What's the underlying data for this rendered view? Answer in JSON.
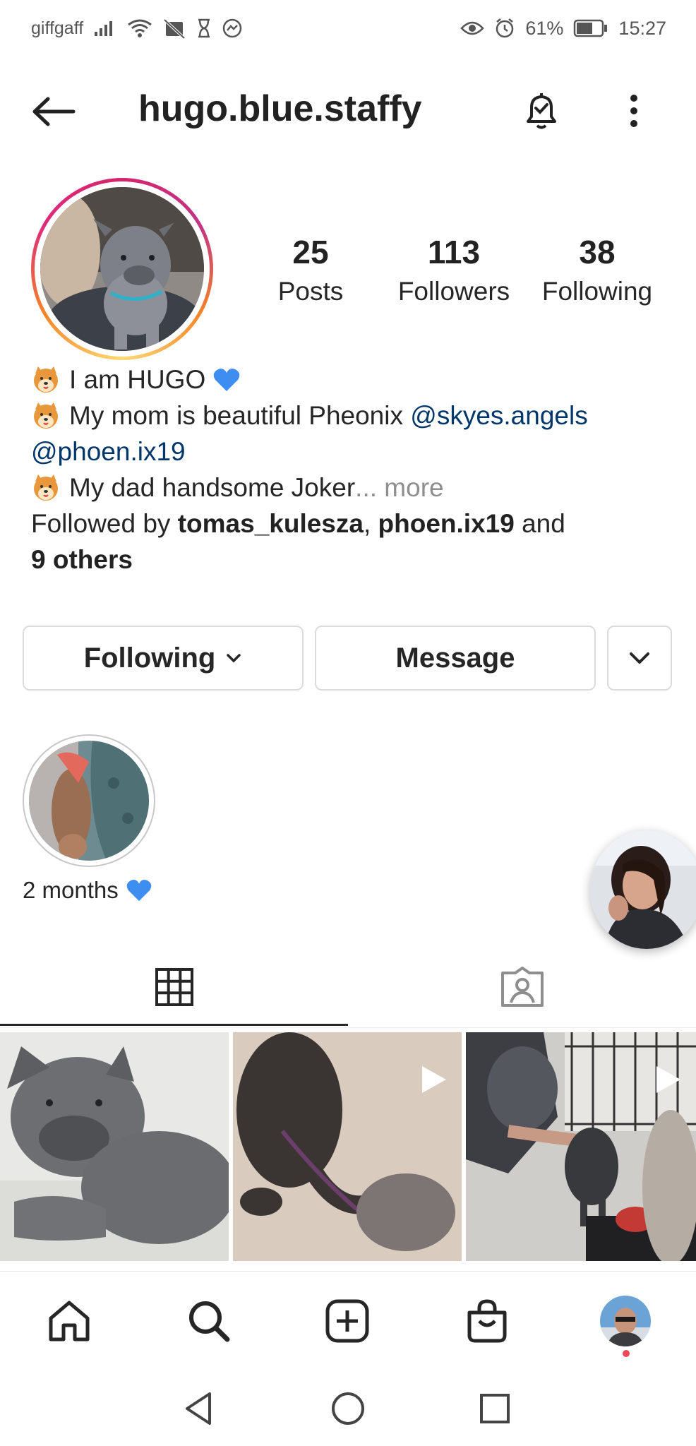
{
  "status_bar": {
    "carrier": "giffgaff",
    "battery": "61%",
    "time": "15:27"
  },
  "header": {
    "username": "hugo.blue.staffy"
  },
  "stats": {
    "posts_count": "25",
    "posts_label": "Posts",
    "followers_count": "113",
    "followers_label": "Followers",
    "following_count": "38",
    "following_label": "Following"
  },
  "bio": {
    "line1": "I am HUGO",
    "line2_prefix": "My mom is beautiful Pheonix",
    "line2_mention": "@skyes.angels",
    "line3_mention": "@phoen.ix19",
    "line4_text": "My dad handsome Joker",
    "line4_more": "... more",
    "followed_prefix": "Followed by",
    "followed_user1": "tomas_kulesza",
    "followed_sep": ",",
    "followed_user2": "phoen.ix19",
    "followed_and": "and",
    "followed_others": "9 others"
  },
  "actions": {
    "following_label": "Following",
    "message_label": "Message"
  },
  "highlight": {
    "label": "2 months"
  },
  "colors": {
    "link": "#00376b",
    "muted": "#8e8e8e",
    "heart_blue": "#3d8ef0",
    "notification_dot": "#ed4956"
  },
  "icons": {
    "header": [
      "back-arrow-icon",
      "bell-check-icon",
      "more-vertical-icon"
    ],
    "tabs": [
      "grid-icon",
      "tagged-icon"
    ],
    "bottom_nav": [
      "home-icon",
      "search-icon",
      "new-post-icon",
      "shop-icon",
      "profile-avatar"
    ],
    "system_nav": [
      "back-triangle-icon",
      "home-circle-icon",
      "recents-square-icon"
    ]
  }
}
